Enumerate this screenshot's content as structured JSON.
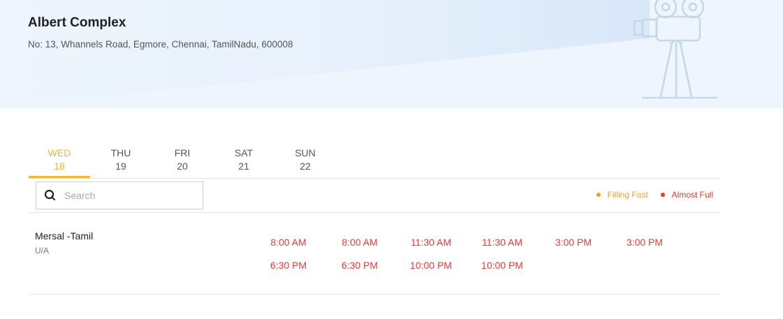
{
  "cinema": {
    "name": "Albert Complex",
    "address": "No: 13, Whannels Road, Egmore, Chennai, TamilNadu, 600008"
  },
  "date_tabs": [
    {
      "day": "WED",
      "date": "18",
      "active": true
    },
    {
      "day": "THU",
      "date": "19",
      "active": false
    },
    {
      "day": "FRI",
      "date": "20",
      "active": false
    },
    {
      "day": "SAT",
      "date": "21",
      "active": false
    },
    {
      "day": "SUN",
      "date": "22",
      "active": false
    }
  ],
  "search": {
    "placeholder": "Search",
    "value": ""
  },
  "legend": {
    "filling_fast": "Filling Fast",
    "almost_full": "Almost Full",
    "filling_fast_color": "#f0a02a",
    "almost_full_color": "#e53935"
  },
  "movies": [
    {
      "title": "Mersal -Tamil",
      "certificate": "U/A",
      "showtimes": [
        "8:00 AM",
        "8:00 AM",
        "11:30 AM",
        "11:30 AM",
        "3:00 PM",
        "3:00 PM",
        "6:30 PM",
        "6:30 PM",
        "10:00 PM",
        "10:00 PM"
      ]
    }
  ],
  "colors": {
    "accent": "#f0b631",
    "showtime": "#e53935",
    "hero_bg": "#eef5fd"
  },
  "icons": {
    "search": "search-icon",
    "projector": "movie-projector-icon"
  }
}
